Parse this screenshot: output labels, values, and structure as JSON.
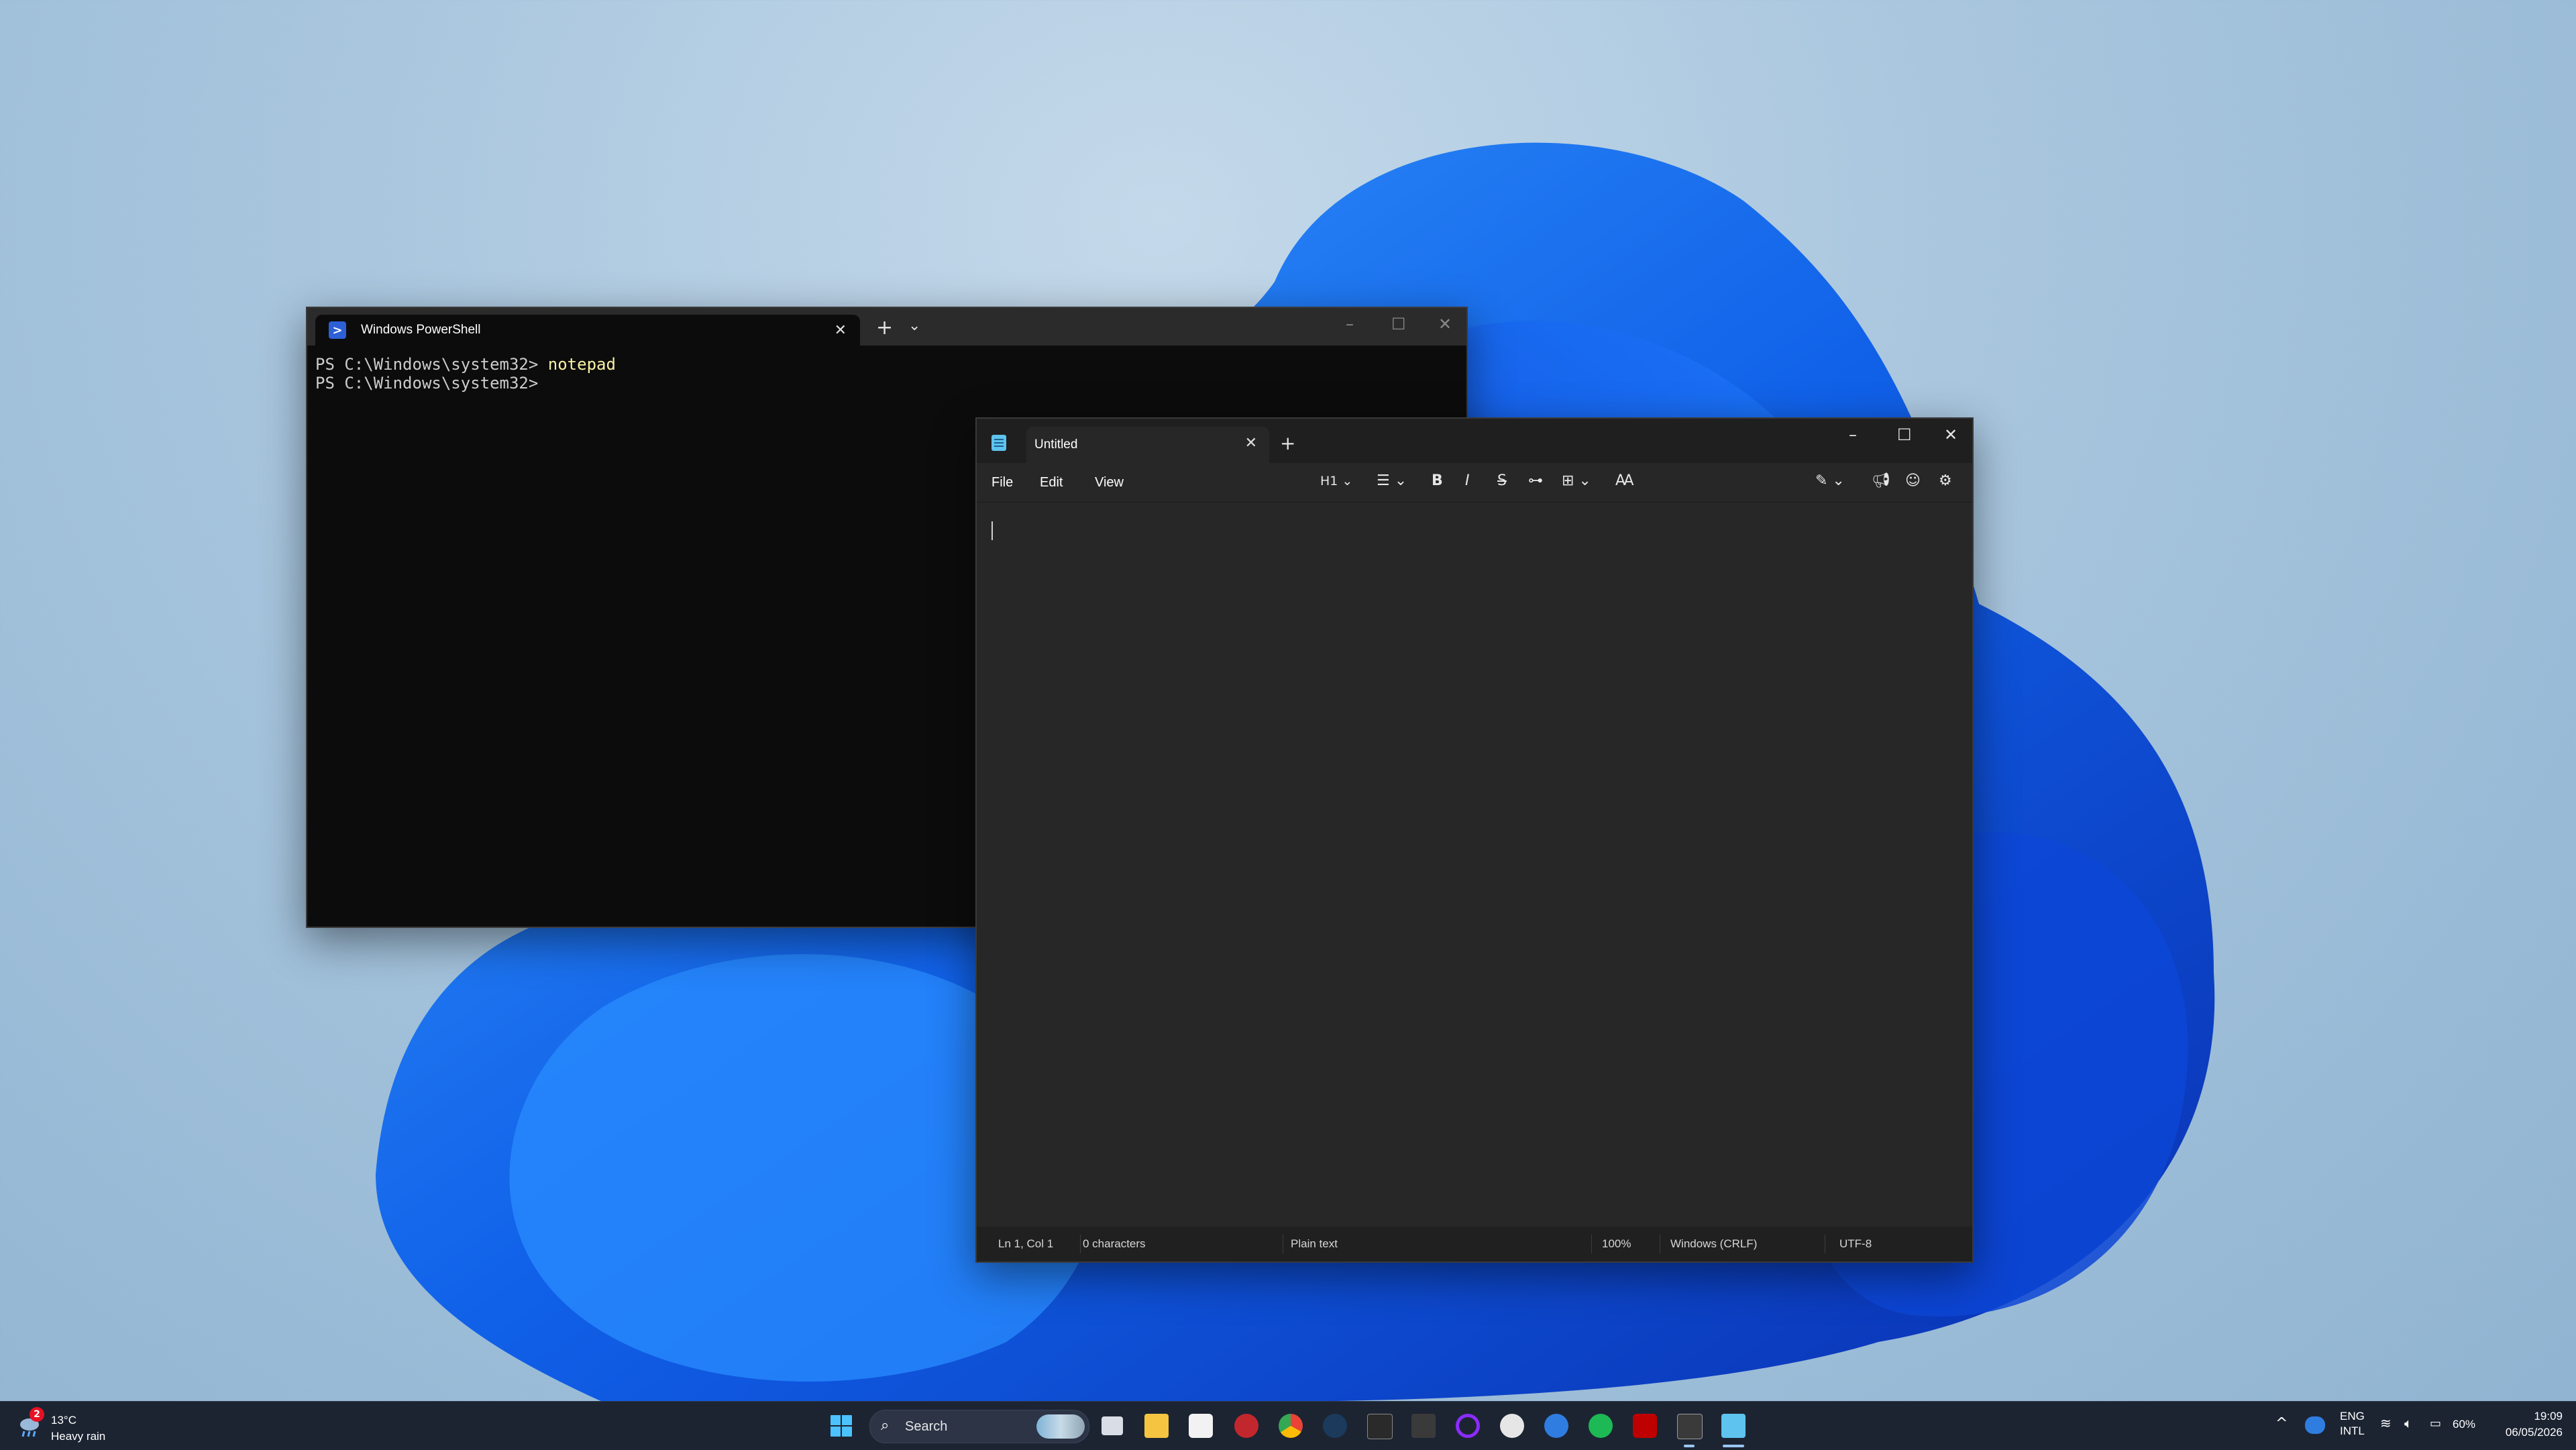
{
  "terminal": {
    "tab_title": "Windows PowerShell",
    "ps_icon": "powershell-icon",
    "close_glyph": "✕",
    "newtab_glyph": "+",
    "dropdown_glyph": "⌄",
    "minimize_glyph": "–",
    "maximize_glyph": "☐",
    "lines": [
      {
        "prompt": "PS C:\\Windows\\system32> ",
        "command": "notepad"
      },
      {
        "prompt": "PS C:\\Windows\\system32> ",
        "command": ""
      }
    ]
  },
  "notepad": {
    "tab_title": "Untitled",
    "menus": [
      "File",
      "Edit",
      "View"
    ],
    "toolbar": {
      "heading": "H1",
      "list_icon": "list-icon",
      "bold": "B",
      "italic": "I",
      "strike": "S",
      "link_icon": "link-icon",
      "table_icon": "table-icon",
      "clear_format_icon": "clear-format-icon",
      "copilot_icon": "copilot-icon",
      "feedback_icon": "megaphone-icon",
      "account_icon": "account-icon",
      "settings_icon": "gear-icon"
    },
    "status": {
      "position": "Ln 1, Col 1",
      "chars": "0 characters",
      "format": "Plain text",
      "zoom": "100%",
      "line_ending": "Windows (CRLF)",
      "encoding": "UTF-8"
    }
  },
  "taskbar": {
    "weather": {
      "badge": "2",
      "temp": "13°C",
      "desc": "Heavy rain"
    },
    "search_placeholder": "Search",
    "apps": [
      "start-icon",
      "task-view-icon",
      "file-explorer-icon",
      "microsoft-store-icon",
      "app-red-icon",
      "chrome-icon",
      "steam-icon",
      "epic-games-icon",
      "amazon-games-icon",
      "purple-ring-icon",
      "obs-icon",
      "app-blue-icon",
      "spotify-icon",
      "filezilla-icon",
      "terminal-icon",
      "notepad-icon"
    ],
    "tray": {
      "chevron": "^",
      "lang_top": "ENG",
      "lang_bottom": "INTL",
      "battery": "60%",
      "time": "19:09",
      "date": "06/05/2026"
    }
  }
}
